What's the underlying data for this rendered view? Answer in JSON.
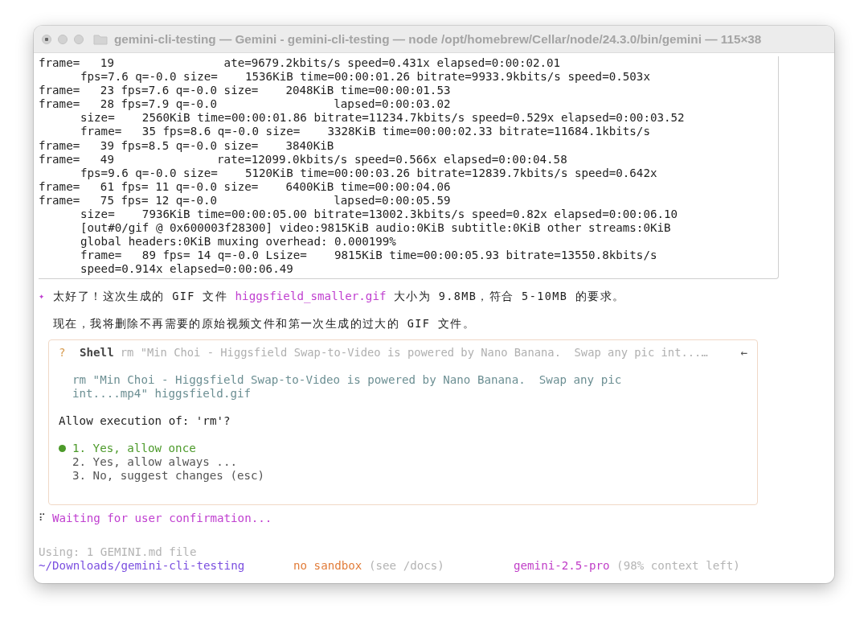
{
  "window": {
    "title": "gemini-cli-testing — Gemini - gemini-cli-testing — node /opt/homebrew/Cellar/node/24.3.0/bin/gemini — 115×38"
  },
  "log_lines": [
    {
      "text": "frame=   19                ate=9679.2kbits/s speed=0.431x elapsed=0:00:02.01",
      "indented": false
    },
    {
      "text": "fps=7.6 q=-0.0 size=    1536KiB time=00:00:01.26 bitrate=9933.9kbits/s speed=0.503x",
      "indented": true
    },
    {
      "text": "frame=   23 fps=7.6 q=-0.0 size=    2048KiB time=00:00:01.53",
      "indented": false
    },
    {
      "text": "frame=   28 fps=7.9 q=-0.0                 lapsed=0:00:03.02",
      "indented": false
    },
    {
      "text": "size=    2560KiB time=00:00:01.86 bitrate=11234.7kbits/s speed=0.529x elapsed=0:00:03.52",
      "indented": true
    },
    {
      "text": "frame=   35 fps=8.6 q=-0.0 size=    3328KiB time=00:00:02.33 bitrate=11684.1kbits/s",
      "indented": true
    },
    {
      "text": "frame=   39 fps=8.5 q=-0.0 size=    3840KiB",
      "indented": false
    },
    {
      "text": "frame=   49               rate=12099.0kbits/s speed=0.566x elapsed=0:00:04.58",
      "indented": false
    },
    {
      "text": "fps=9.6 q=-0.0 size=    5120KiB time=00:00:03.26 bitrate=12839.7kbits/s speed=0.642x",
      "indented": true
    },
    {
      "text": "frame=   61 fps= 11 q=-0.0 size=    6400KiB time=00:00:04.06",
      "indented": false
    },
    {
      "text": "frame=   75 fps= 12 q=-0.0                 lapsed=0:00:05.59",
      "indented": false
    },
    {
      "text": "size=    7936KiB time=00:00:05.00 bitrate=13002.3kbits/s speed=0.82x elapsed=0:00:06.10",
      "indented": true
    },
    {
      "text": "[out#0/gif @ 0x600003f28300] video:9815KiB audio:0KiB subtitle:0KiB other streams:0KiB",
      "indented": true
    },
    {
      "text": "global headers:0KiB muxing overhead: 0.000199%",
      "indented": true
    },
    {
      "text": "frame=   89 fps= 14 q=-0.0 Lsize=    9815KiB time=00:00:05.93 bitrate=13550.8kbits/s",
      "indented": true
    },
    {
      "text": "speed=0.914x elapsed=0:00:06.49",
      "indented": true
    }
  ],
  "message": {
    "marker": "✦",
    "parts": [
      {
        "text": "太好了！这次生成的 GIF 文件 ",
        "kind": "plain"
      },
      {
        "text": "higgsfield_smaller.gif",
        "kind": "file"
      },
      {
        "text": " 大小为 9.8MB，符合 5-10MB 的要求。",
        "kind": "plain"
      }
    ]
  },
  "note": "现在，我将删除不再需要的原始视频文件和第一次生成的过大的 GIF 文件。",
  "confirm": {
    "mark": "?",
    "tool": "Shell",
    "summary": "rm \"Min Choi - Higgsfield Swap-to-Video is powered by Nano Banana.  Swap any pic int...…",
    "back": "←",
    "command_lines": [
      "rm \"Min Choi - Higgsfield Swap-to-Video is powered by Nano Banana.  Swap any pic",
      "int....mp4\" higgsfield.gif"
    ],
    "question": "Allow execution of: 'rm'?",
    "options": [
      {
        "label": "1. Yes, allow once",
        "selected": true
      },
      {
        "label": "2. Yes, allow always ...",
        "selected": false
      },
      {
        "label": "3. No, suggest changes (esc)",
        "selected": false
      }
    ]
  },
  "status": {
    "spinner": "⠏",
    "text": "Waiting for user confirmation..."
  },
  "footer": {
    "using": "Using: 1 GEMINI.md file",
    "path": "~/Downloads/gemini-cli-testing",
    "sandbox": "no sandbox",
    "sandbox_hint": "(see /docs)",
    "model": "gemini-2.5-pro",
    "context": "(98% context left)"
  }
}
